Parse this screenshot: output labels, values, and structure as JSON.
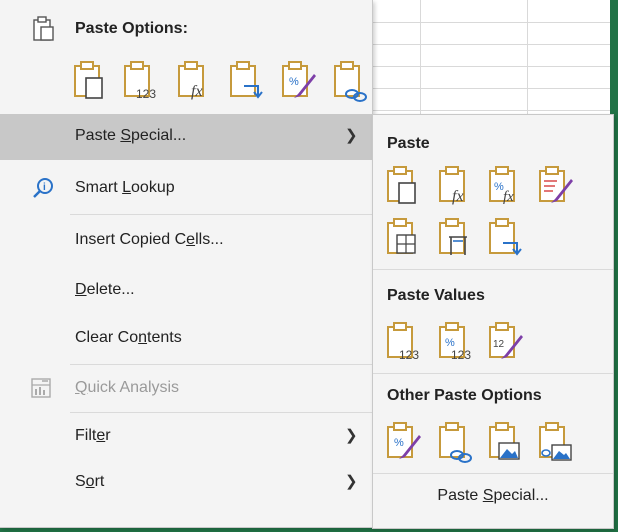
{
  "menu": {
    "paste_options_label": "Paste Options:",
    "paste_option_icons": [
      "paste-icon",
      "paste-values-icon",
      "paste-formulas-icon",
      "paste-transpose-icon",
      "paste-formatting-icon",
      "paste-link-icon"
    ],
    "items": [
      {
        "label_pre": "Paste ",
        "label_u": "S",
        "label_post": "pecial...",
        "has_submenu": true,
        "highlighted": true
      },
      {
        "label_pre": "Smart ",
        "label_u": "L",
        "label_post": "ookup",
        "icon": "search-icon"
      },
      {
        "label_pre": "Insert Copied C",
        "label_u": "e",
        "label_post": "lls..."
      },
      {
        "label_pre": "",
        "label_u": "D",
        "label_post": "elete..."
      },
      {
        "label_pre": "Clear Co",
        "label_u": "n",
        "label_post": "tents"
      },
      {
        "label_pre": "",
        "label_u": "Q",
        "label_post": "uick Analysis",
        "disabled": true,
        "icon": "quick-analysis-icon"
      },
      {
        "label_pre": "Filt",
        "label_u": "e",
        "label_post": "r",
        "has_submenu": true
      },
      {
        "label_pre": "S",
        "label_u": "o",
        "label_post": "rt",
        "has_submenu": true
      }
    ]
  },
  "submenu": {
    "paste_title": "Paste",
    "paste_icons": [
      "paste-icon",
      "paste-formulas-icon",
      "paste-formulas-number-format-icon",
      "paste-keep-source-formatting-icon",
      "paste-no-borders-icon",
      "paste-keep-column-widths-icon",
      "paste-transpose-icon"
    ],
    "values_title": "Paste Values",
    "values_icons": [
      "paste-values-icon",
      "paste-values-number-format-icon",
      "paste-values-source-formatting-icon"
    ],
    "other_title": "Other Paste Options",
    "other_icons": [
      "paste-formatting-icon",
      "paste-link-icon",
      "paste-picture-icon",
      "paste-linked-picture-icon"
    ],
    "special_pre": "Paste ",
    "special_u": "S",
    "special_post": "pecial..."
  },
  "colors": {
    "clipboard": "#c69a3c",
    "paper": "#ffffff",
    "accent_blue": "#2a72c8",
    "brush_purple": "#7d3fa8",
    "excel_green": "#217346"
  }
}
